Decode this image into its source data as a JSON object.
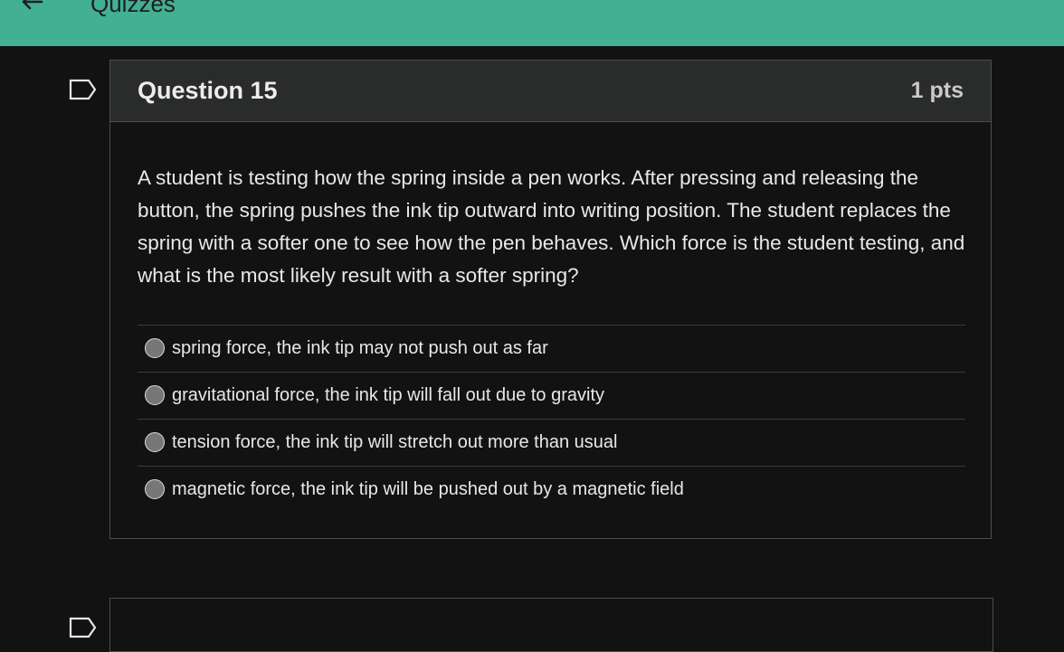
{
  "topbar": {
    "title": "Quizzes",
    "back_icon": "arrow-left-icon",
    "color": "#42b092"
  },
  "question": {
    "title": "Question 15",
    "points": "1 pts",
    "flag_icon": "flag-icon",
    "text": "A student is testing how the spring inside a pen works. After pressing and releasing the button, the spring pushes the ink tip outward into writing position. The student replaces the spring with a softer one to see how the pen behaves. Which force is the student testing, and what is the most likely result with a softer spring?",
    "answers": [
      {
        "label": "spring force, the ink tip may not push out as far"
      },
      {
        "label": "gravitational force, the ink tip will fall out due to gravity"
      },
      {
        "label": "tension force, the ink tip will stretch out more than usual"
      },
      {
        "label": "magnetic force, the ink tip will be pushed out by a magnetic field"
      }
    ]
  },
  "next_question": {
    "flag_icon": "flag-icon"
  }
}
